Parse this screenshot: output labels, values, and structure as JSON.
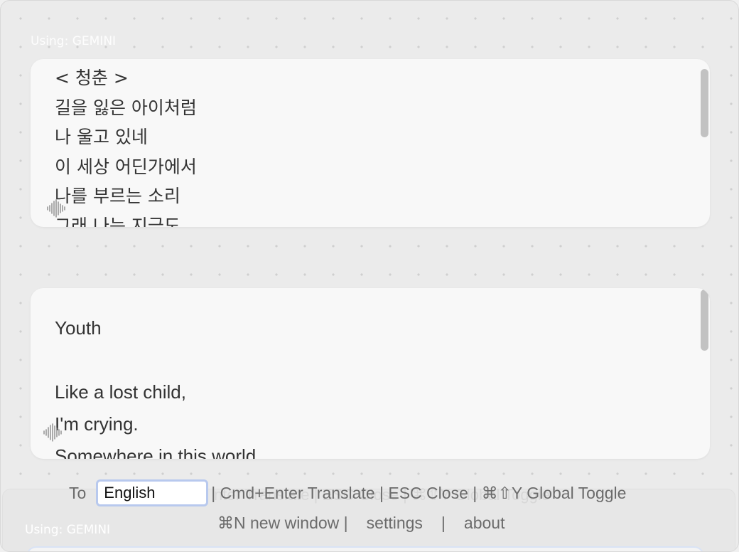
{
  "provider_label": "Using: GEMINI",
  "source_panel": {
    "text": "< 청춘 >\n길을 잃은 아이처럼\n나 울고 있네\n이 세상 어딘가에서\n나를 부르는 소리\n그래 나는 지금도"
  },
  "target_panel": {
    "text": "Youth\n\nLike a lost child,\nI'm crying.\nSomewhere in this world"
  },
  "toolbar": {
    "to_label": "To",
    "target_language": "English",
    "shortcut_hint": "| Cmd+Enter Translate | ESC Close | ⌘⇧Y Global Toggle",
    "new_window_label": "⌘N new window |",
    "settings_label": "settings",
    "separator": "|",
    "about_label": "about"
  },
  "ghost_window": {
    "provider_label": "Using: GEMINI",
    "hint": "nter Translate | ESC Close | ⌘⇧Y Global Toggle"
  },
  "icons": {
    "voice": "waveform-icon"
  }
}
